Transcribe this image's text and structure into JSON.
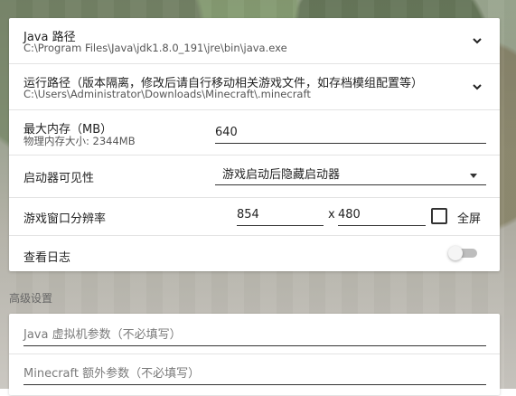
{
  "settings": {
    "java_path": {
      "title": "Java 路径",
      "value": "C:\\Program Files\\Java\\jdk1.8.0_191\\jre\\bin\\java.exe"
    },
    "run_path": {
      "title": "运行路径（版本隔离，修改后请自行移动相关游戏文件，如存档模组配置等）",
      "value": "C:\\Users\\Administrator\\Downloads\\Minecraft\\.minecraft"
    },
    "memory": {
      "title": "最大内存（MB）",
      "physical": "物理内存大小: 2344MB",
      "value": "640"
    },
    "launcher_visibility": {
      "title": "启动器可见性",
      "selected": "游戏启动后隐藏启动器"
    },
    "window_resolution": {
      "title": "游戏窗口分辨率",
      "width": "854",
      "separator": "x",
      "height": "480",
      "fullscreen_label": "全屏"
    },
    "view_log": {
      "title": "查看日志"
    }
  },
  "advanced": {
    "title": "高级设置",
    "jvm_args_placeholder": "Java 虚拟机参数（不必填写）",
    "mc_args_placeholder": "Minecraft 额外参数（不必填写）"
  },
  "icons": {
    "expand": "chevron-down-icon",
    "dropdown": "caret-down-icon",
    "checkbox": "checkbox-icon",
    "toggle": "toggle-switch"
  },
  "colors": {
    "card_bg": "#ffffff",
    "text": "#222222",
    "muted": "#555555",
    "divider": "#e3e3e3",
    "toggle_off": "#bdbdbd"
  }
}
